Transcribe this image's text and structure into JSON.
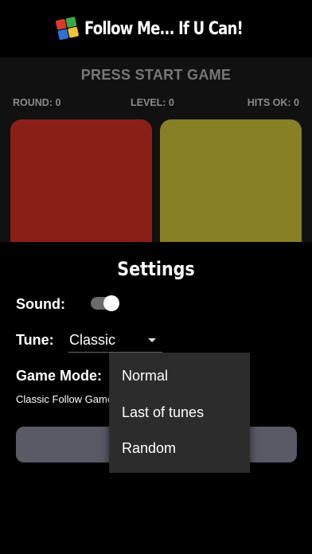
{
  "header": {
    "title": "Follow Me... If U Can!",
    "logo_icon": "four-squares-logo"
  },
  "game": {
    "status": "PRESS START GAME",
    "round": "ROUND: 0",
    "level": "LEVEL: 0",
    "hits": "HITS OK: 0",
    "pad_colors": {
      "red": "#8a1f18",
      "yellow": "#888024"
    }
  },
  "settings": {
    "title": "Settings",
    "sound_label": "Sound:",
    "sound_on": true,
    "tune_label": "Tune:",
    "tune_value": "Classic",
    "mode_label": "Game Mode:",
    "mode_description": "Classic Follow  Game"
  },
  "mode_menu": {
    "options": [
      "Normal",
      "Last of tunes",
      "Random"
    ]
  }
}
